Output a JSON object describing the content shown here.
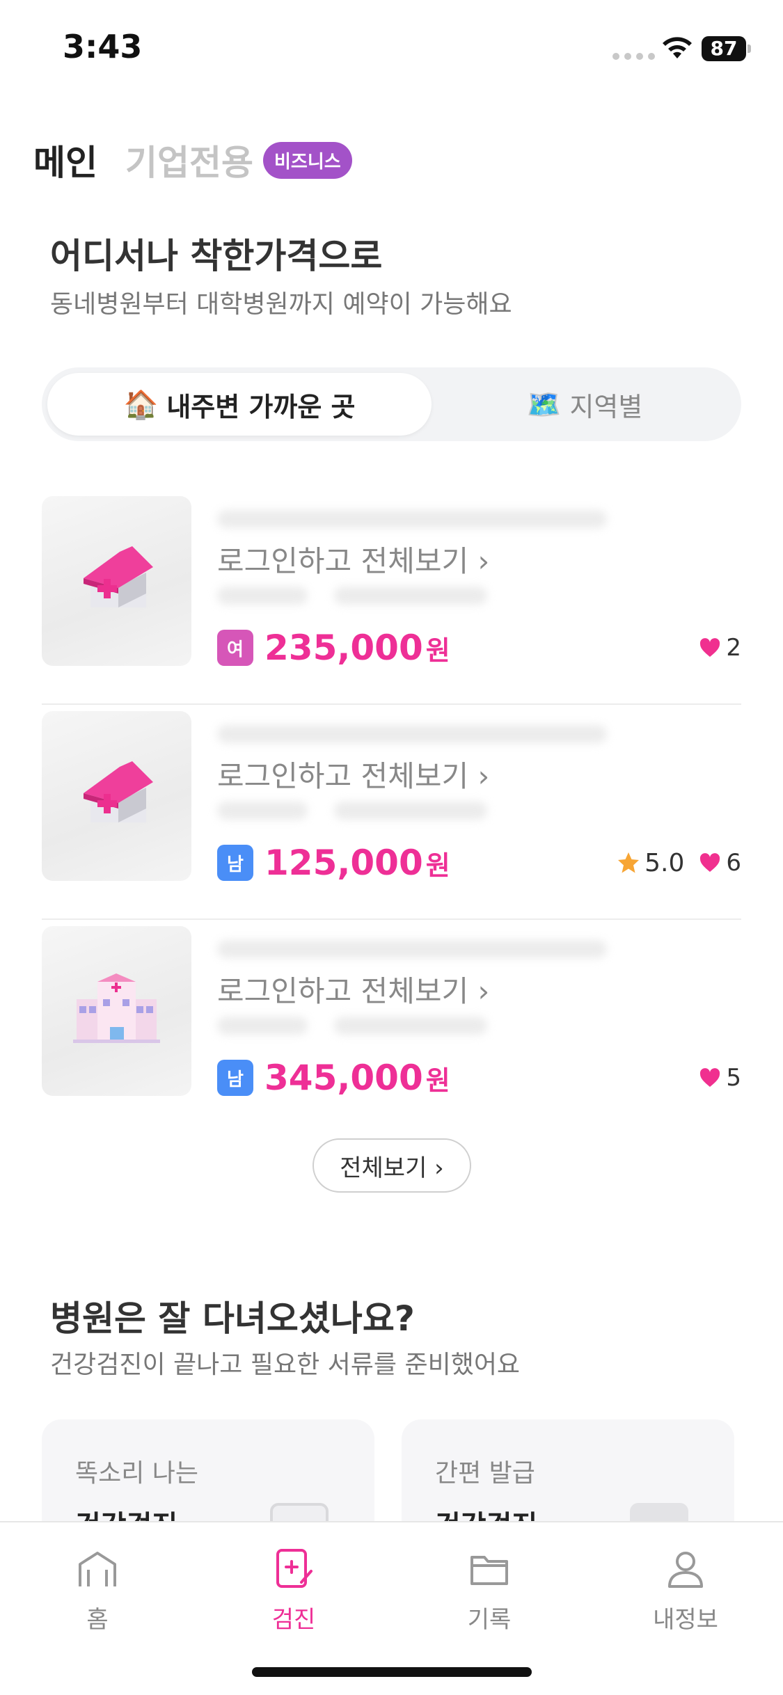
{
  "status_bar": {
    "time": "3:43",
    "battery": "87"
  },
  "top_tabs": {
    "main": "메인",
    "business": "기업전용",
    "business_badge": "비즈니스"
  },
  "section1": {
    "title": "어디서나 착한가격으로",
    "subtitle": "동네병원부터 대학병원까지 예약이 가능해요"
  },
  "segment": {
    "nearby": {
      "emoji": "🏠",
      "label": "내주변 가까운 곳"
    },
    "region": {
      "emoji": "🗺️",
      "label": "지역별"
    }
  },
  "hospitals": [
    {
      "login_text": "로그인하고 전체보기 ›",
      "gender": "여",
      "gender_color": "#d656b8",
      "price": "235,000",
      "currency": "원",
      "rating": "",
      "likes": "2",
      "thumb_icon": "house-medical-icon"
    },
    {
      "login_text": "로그인하고 전체보기 ›",
      "gender": "남",
      "gender_color": "#4a8ef7",
      "price": "125,000",
      "currency": "원",
      "rating": "5.0",
      "likes": "6",
      "thumb_icon": "house-medical-icon"
    },
    {
      "login_text": "로그인하고 전체보기 ›",
      "gender": "남",
      "gender_color": "#4a8ef7",
      "price": "345,000",
      "currency": "원",
      "rating": "",
      "likes": "5",
      "thumb_icon": "hospital-building-icon"
    }
  ],
  "view_all": "전체보기 ›",
  "section2": {
    "title": "병원은 잘 다녀오셨나요?",
    "subtitle": "건강검진이 끝나고 필요한 서류를 준비했어요"
  },
  "cards": [
    {
      "label": "똑소리 나는",
      "title": "건강검진"
    },
    {
      "label": "간편 발급",
      "title": "건강검진"
    }
  ],
  "bottom_nav": [
    {
      "label": "홈",
      "icon": "home-icon",
      "active": false
    },
    {
      "label": "검진",
      "icon": "checkup-icon",
      "active": true
    },
    {
      "label": "기록",
      "icon": "folder-icon",
      "active": false
    },
    {
      "label": "내정보",
      "icon": "profile-icon",
      "active": false
    }
  ],
  "colors": {
    "accent": "#ee2f96",
    "business_badge": "#a352c8",
    "female": "#d656b8",
    "male": "#4a8ef7"
  }
}
